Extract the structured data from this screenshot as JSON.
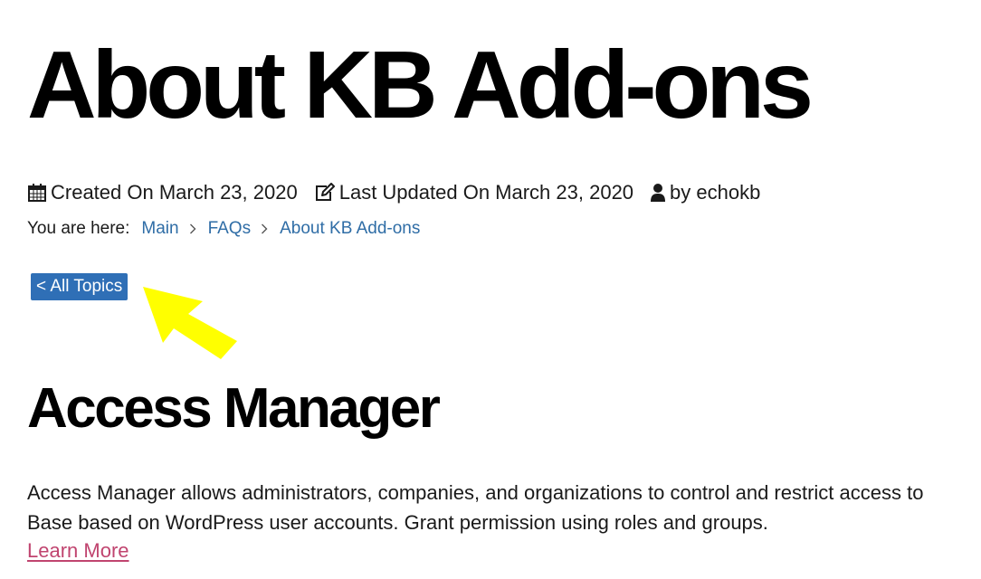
{
  "page": {
    "title": "About KB Add-ons"
  },
  "meta": {
    "created": "Created On March 23, 2020",
    "updated": "Last Updated On March 23, 2020",
    "author": "by echokb",
    "icons": [
      "calendar-icon",
      "edit-icon",
      "user-icon"
    ]
  },
  "breadcrumb": {
    "label": "You are here:",
    "items": [
      "Main",
      "FAQs",
      "About KB Add-ons"
    ],
    "separator_icon": "chevron-right-icon"
  },
  "back_button": {
    "label": "< All Topics",
    "color": "#2f6fb6"
  },
  "annotation": {
    "icon": "yellow-arrow-icon",
    "color": "#ffff00"
  },
  "section": {
    "heading": "Access Manager",
    "description_lines": [
      "Access Manager allows administrators, companies, and organizations to control and restrict access to",
      "Base based on WordPress user accounts. Grant permission using roles and groups."
    ],
    "link_label": "Learn More",
    "link_color": "#c0446f"
  },
  "colors": {
    "breadcrumb_link": "#2f6da6",
    "text": "#1a1a1a"
  }
}
